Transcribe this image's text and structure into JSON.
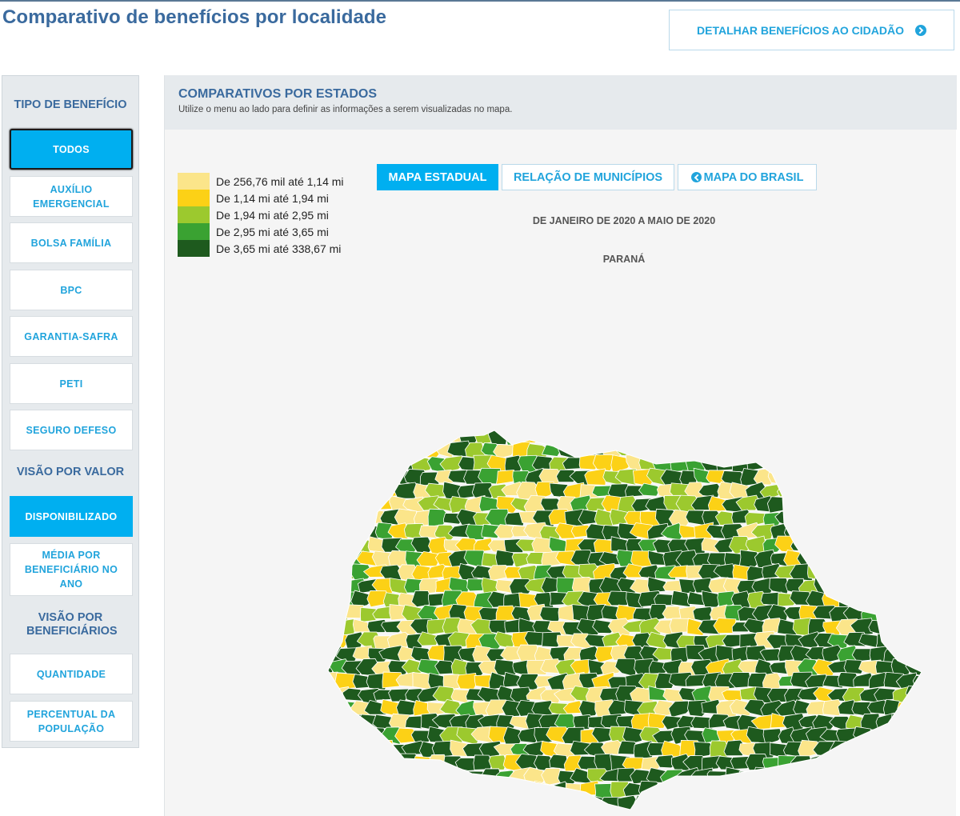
{
  "page": {
    "title": "Comparativo de benefícios por localidade",
    "detail_button": "DETALHAR BENEFÍCIOS AO CIDADÃO"
  },
  "sidebar": {
    "benefit_type_heading": "TIPO DE BENEFÍCIO",
    "benefit_types": [
      "TODOS",
      "AUXÍLIO EMERGENCIAL",
      "BOLSA FAMÍLIA",
      "BPC",
      "GARANTIA-SAFRA",
      "PETI",
      "SEGURO DEFESO"
    ],
    "value_heading": "VISÃO POR VALOR",
    "value_options": [
      "DISPONIBILIZADO",
      "MÉDIA POR BENEFICIÁRIO NO ANO"
    ],
    "beneficiaries_heading": "VISÃO POR BENEFICIÁRIOS",
    "beneficiary_options": [
      "QUANTIDADE",
      "PERCENTUAL DA POPULAÇÃO"
    ]
  },
  "main": {
    "title": "COMPARATIVOS POR ESTADOS",
    "subtitle": "Utilize o menu ao lado para definir as informações a serem visualizadas no mapa.",
    "tabs": [
      "MAPA ESTADUAL",
      "RELAÇÃO DE MUNICÍPIOS",
      "MAPA DO BRASIL"
    ],
    "period": "DE JANEIRO DE 2020 A MAIO DE 2020",
    "state": "PARANÁ"
  },
  "legend": [
    {
      "label": "De 256,76 mil até 1,14 mi",
      "color": "#fbe58a"
    },
    {
      "label": "De 1,14 mi até 1,94 mi",
      "color": "#fcd116"
    },
    {
      "label": "De 1,94 mi até 2,95 mi",
      "color": "#9cc92e"
    },
    {
      "label": "De 2,95 mi até 3,65 mi",
      "color": "#3aa232"
    },
    {
      "label": "De 3,65 mi até 338,67 mi",
      "color": "#1e5a1e"
    }
  ],
  "colors": {
    "accent": "#00aff0",
    "title": "#3a6a9e",
    "map_border": "#ffffff"
  }
}
